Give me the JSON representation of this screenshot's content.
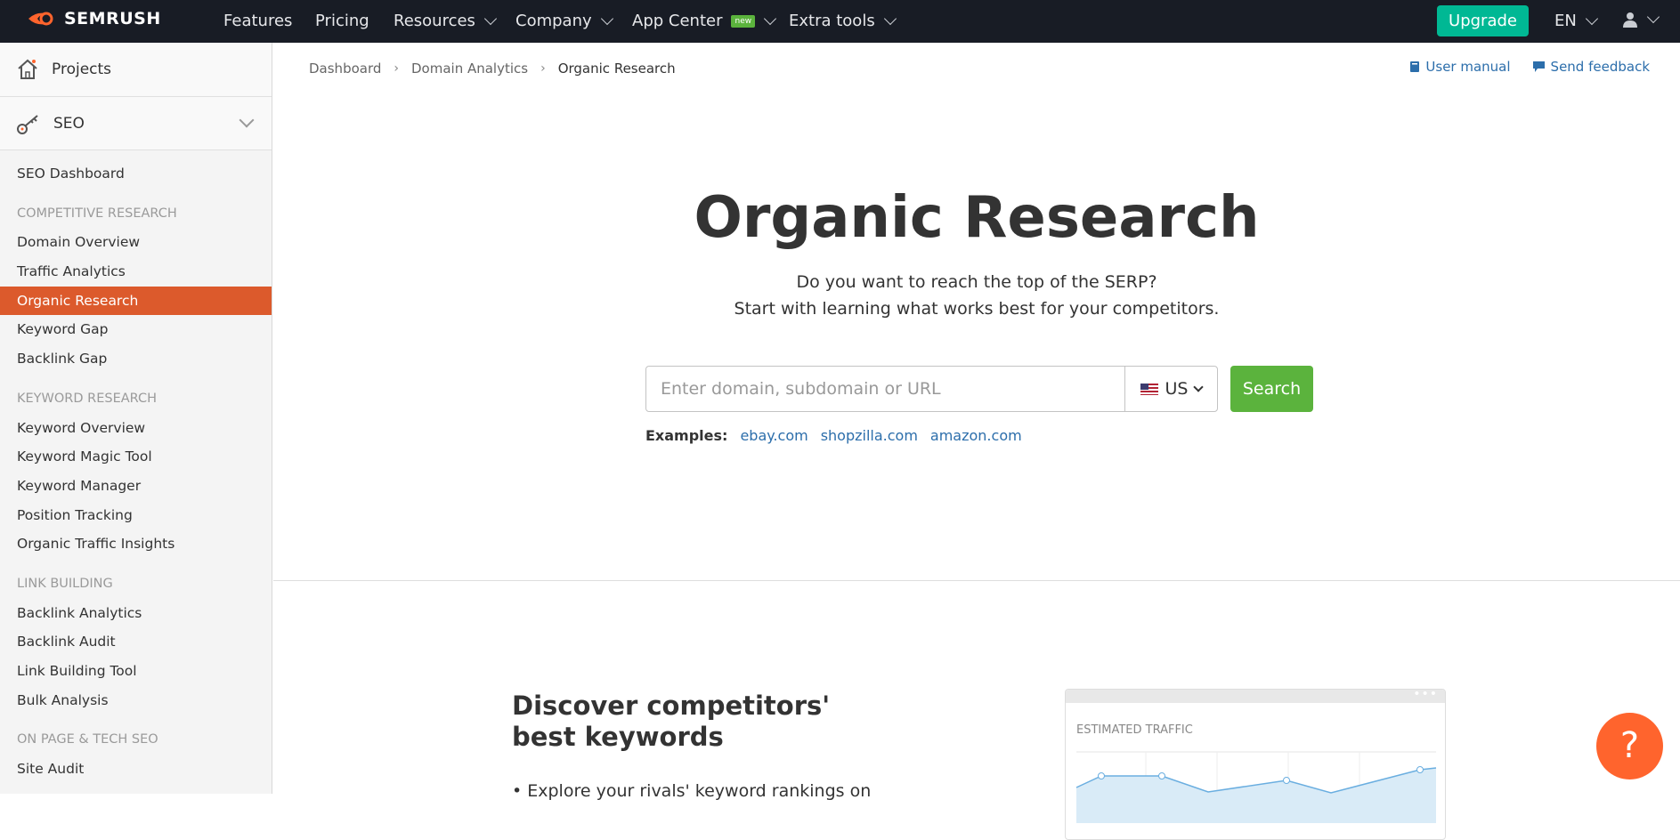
{
  "topnav": {
    "logo": "SEMRUSH",
    "items": [
      {
        "label": "Features"
      },
      {
        "label": "Pricing"
      },
      {
        "label": "Resources"
      },
      {
        "label": "Company"
      },
      {
        "label": "App Center",
        "badge": "new"
      },
      {
        "label": "Extra tools"
      }
    ],
    "upgrade": "Upgrade",
    "language": "EN"
  },
  "sidebar": {
    "projects": "Projects",
    "seo": "SEO",
    "dashboard": "SEO Dashboard",
    "sections": [
      {
        "heading": "COMPETITIVE RESEARCH",
        "items": [
          "Domain Overview",
          "Traffic Analytics",
          "Organic Research",
          "Keyword Gap",
          "Backlink Gap"
        ]
      },
      {
        "heading": "KEYWORD RESEARCH",
        "items": [
          "Keyword Overview",
          "Keyword Magic Tool",
          "Keyword Manager",
          "Position Tracking",
          "Organic Traffic Insights"
        ]
      },
      {
        "heading": "LINK BUILDING",
        "items": [
          "Backlink Analytics",
          "Backlink Audit",
          "Link Building Tool",
          "Bulk Analysis"
        ]
      },
      {
        "heading": "ON PAGE & TECH SEO",
        "items": [
          "Site Audit"
        ]
      }
    ],
    "active": "Organic Research"
  },
  "breadcrumb": [
    "Dashboard",
    "Domain Analytics",
    "Organic Research"
  ],
  "links": {
    "manual": "User manual",
    "feedback": "Send feedback"
  },
  "hero": {
    "title": "Organic Research",
    "line1": "Do you want to reach the top of the SERP?",
    "line2": "Start with learning what works best for your competitors."
  },
  "search": {
    "placeholder": "Enter domain, subdomain or URL",
    "database": "US",
    "button": "Search"
  },
  "examples": {
    "label": "Examples:",
    "items": [
      "ebay.com",
      "shopzilla.com",
      "amazon.com"
    ]
  },
  "discover": {
    "title": "Discover competitors' best keywords",
    "bullet": "Explore your rivals' keyword rankings on"
  },
  "preview": {
    "label": "ESTIMATED TRAFFIC"
  },
  "help": "?",
  "colors": {
    "accent": "#dc5a2c",
    "green": "#5bb33d",
    "link": "#2c6eab",
    "topbar": "#181c25",
    "help": "#ff642d"
  }
}
